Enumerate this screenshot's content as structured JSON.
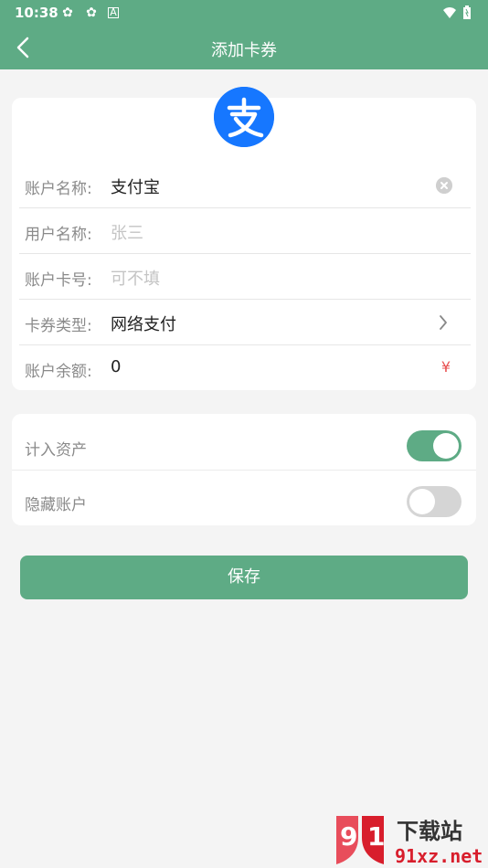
{
  "status_bar": {
    "time": "10:38",
    "icons": [
      "notification-icon",
      "notification-icon",
      "image-icon",
      "wifi-icon",
      "battery-icon"
    ]
  },
  "app_bar": {
    "title": "添加卡券"
  },
  "account_card": {
    "logo": "alipay-icon",
    "rows": [
      {
        "label": "账户名称:",
        "value": "支付宝",
        "placeholder": ""
      },
      {
        "label": "用户名称:",
        "value": "",
        "placeholder": "张三"
      },
      {
        "label": "账户卡号:",
        "value": "",
        "placeholder": "可不填"
      },
      {
        "label": "卡券类型:",
        "value": "网络支付"
      },
      {
        "label": "账户余额:",
        "value": "0",
        "currency": "¥"
      }
    ]
  },
  "asset_card": {
    "rows": [
      {
        "label": "计入资产",
        "enabled": true
      },
      {
        "label": "隐藏账户",
        "enabled": false
      }
    ]
  },
  "save_button": {
    "label": "保存"
  },
  "watermark": {
    "top": "下载站",
    "bottom": "91xz.net"
  },
  "colors": {
    "primary": "#5eab85",
    "alipay": "#1677ff",
    "currency": "#e85050"
  }
}
